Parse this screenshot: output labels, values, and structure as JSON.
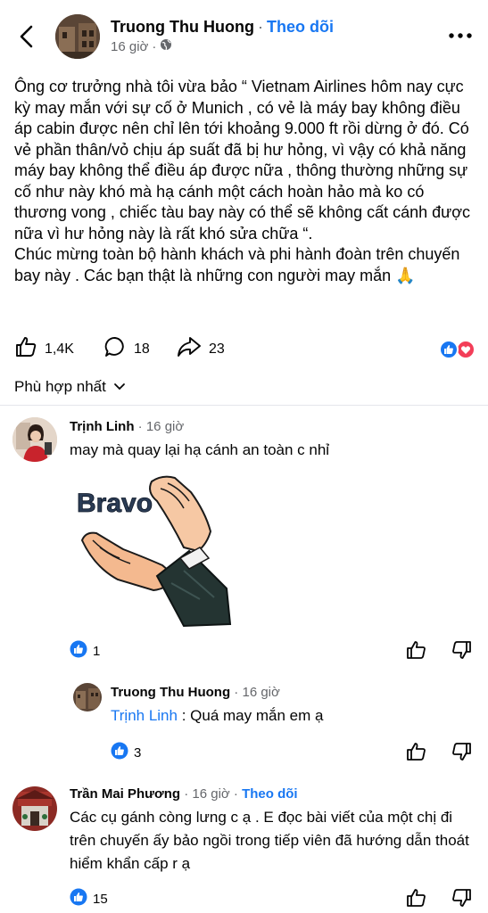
{
  "header": {
    "author": "Truong Thu Huong",
    "separator": "·",
    "follow_label": "Theo dõi",
    "time": "16 giờ"
  },
  "post": {
    "paragraph1": "Ông cơ trưởng nhà tôi vừa bảo “ Vietnam Airlines hôm nay cực kỳ may mắn với sự cố ở Munich , có vẻ là máy bay không điều áp cabin được nên chỉ lên tới khoảng 9.000 ft rồi dừng ở đó. Có vẻ phần thân/vỏ chịu áp suất đã bị hư hỏng, vì vậy có khả năng máy bay không thể điều áp được nữa , thông thường những sự cố như này khó mà hạ cánh một cách hoàn hảo mà ko có thương vong , chiếc tàu bay này có thể sẽ không cất cánh được nữa vì hư hỏng này là rất khó sửa chữa “.",
    "paragraph2": "Chúc mừng toàn bộ hành khách và phi hành đoàn trên chuyến bay này . Các bạn thật là những con người may mắn 🙏"
  },
  "actions": {
    "likes": "1,4K",
    "comments": "18",
    "shares": "23"
  },
  "sort_label": "Phù hợp nhất",
  "comments": [
    {
      "author": "Trịnh Linh",
      "time": "16 giờ",
      "text": "may mà quay lại hạ cánh an toàn c nhỉ",
      "sticker_text": "Bravo",
      "likes": "1"
    },
    {
      "author": "Truong Thu Huong",
      "time": "16 giờ",
      "mention": "Trịnh Linh",
      "text": " : Quá may mắn em ạ",
      "likes": "3"
    },
    {
      "author": "Trần Mai Phương",
      "time": "16 giờ",
      "follow_label": "Theo dõi",
      "text": "Các cụ gánh còng lưng c ạ . E đọc bài viết của một chị đi trên chuyến ấy bảo ngồi trong tiếp viên đã hướng dẫn thoát hiểm khẩn cấp r ạ",
      "likes": "15"
    }
  ],
  "colors": {
    "link": "#1877f2",
    "meta": "#65676b",
    "like_blue": "#1877f2",
    "love_red": "#f33e58"
  }
}
